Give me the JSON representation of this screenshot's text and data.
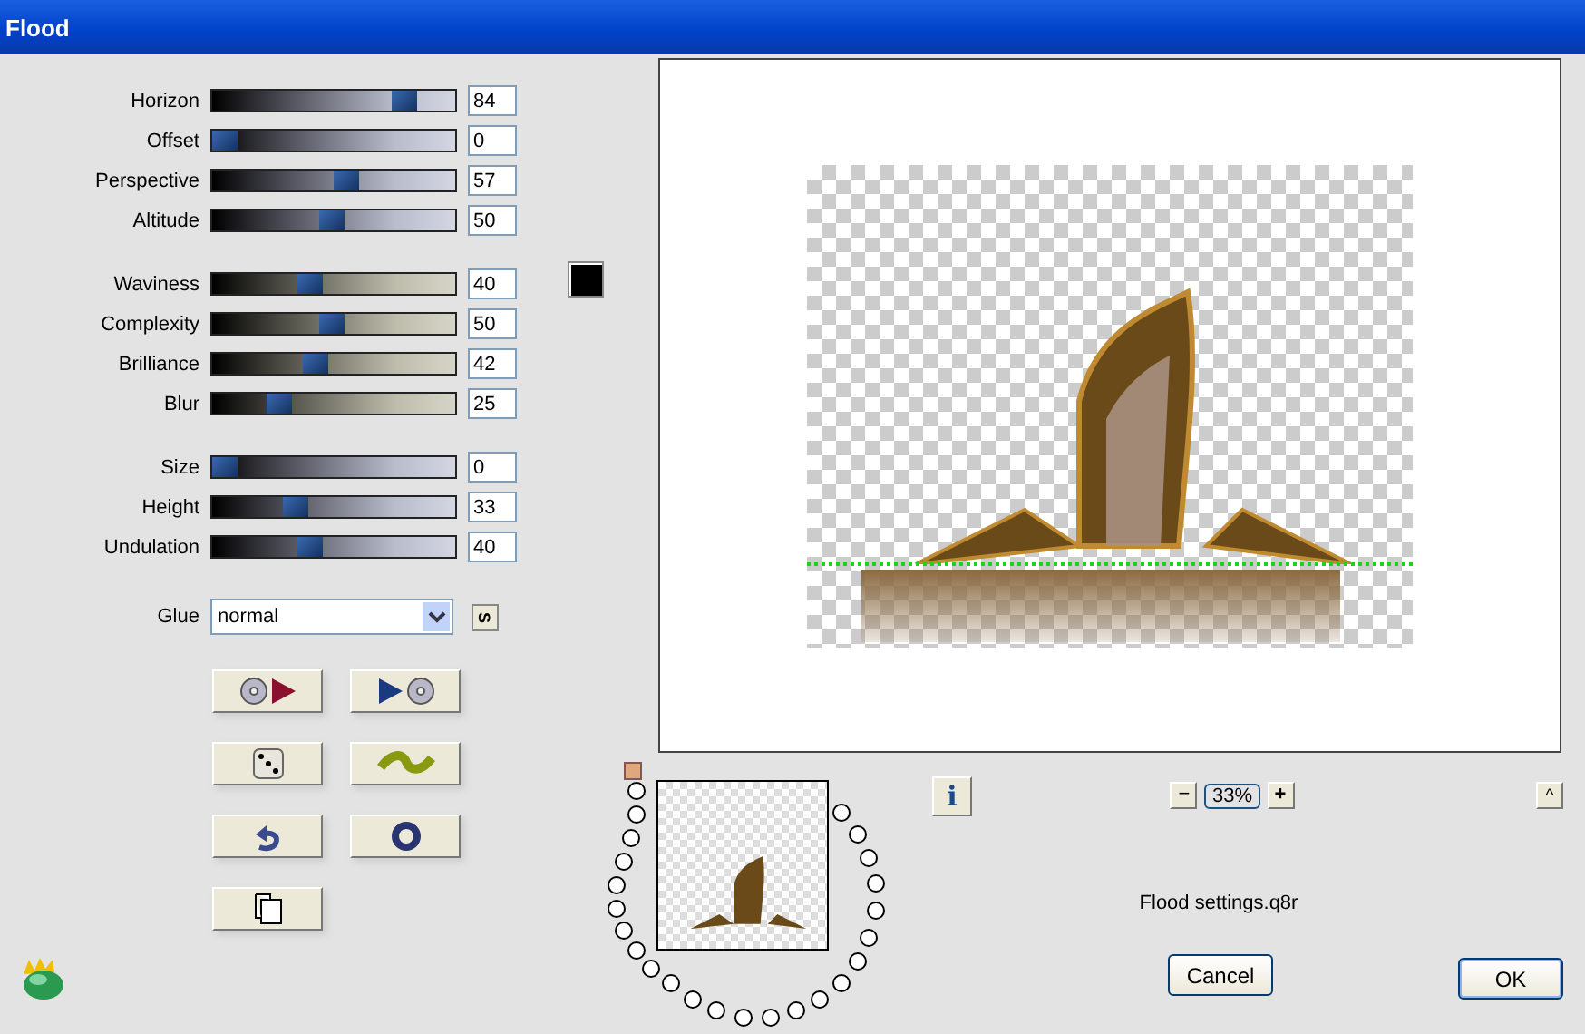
{
  "window": {
    "title": "Flood"
  },
  "slider_groups": [
    {
      "kind": "cool",
      "sliders": [
        {
          "label": "Horizon",
          "level": 0.84,
          "value": "84"
        },
        {
          "label": "Offset",
          "level": 0,
          "value": "0"
        },
        {
          "label": "Perspective",
          "level": 0.57,
          "value": "57"
        },
        {
          "label": "Altitude",
          "level": 0.5,
          "value": "50"
        }
      ]
    },
    {
      "kind": "warm",
      "swatch": {
        "color": "#000000"
      },
      "sliders": [
        {
          "label": "Waviness",
          "level": 0.4,
          "value": "40"
        },
        {
          "label": "Complexity",
          "level": 0.5,
          "value": "50"
        },
        {
          "label": "Brilliance",
          "level": 0.42,
          "value": "42"
        },
        {
          "label": "Blur",
          "level": 0.25,
          "value": "25"
        }
      ]
    },
    {
      "kind": "cool",
      "sliders": [
        {
          "label": "Size",
          "level": 0,
          "value": "0"
        },
        {
          "label": "Height",
          "level": 0.33,
          "value": "33"
        },
        {
          "label": "Undulation",
          "level": 0.4,
          "value": "40"
        }
      ]
    }
  ],
  "glue": {
    "label": "Glue",
    "value": "normal",
    "side_button": "S"
  },
  "tool_buttons": [
    {
      "kind": "load"
    },
    {
      "kind": "save"
    },
    {
      "kind": "random"
    },
    {
      "kind": "wave"
    },
    {
      "kind": "reset"
    },
    {
      "kind": "ring"
    },
    {
      "kind": "copy"
    }
  ],
  "zoom": {
    "minus": "−",
    "value": "33%",
    "plus": "+"
  },
  "info_button": "i",
  "collapse_button": "^",
  "settings_file": "Flood settings.q8r",
  "buttons": [
    {
      "label": "Cancel"
    },
    {
      "label": "OK"
    }
  ]
}
